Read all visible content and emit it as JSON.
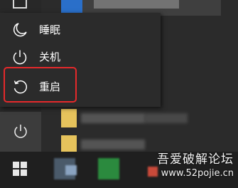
{
  "power_menu": {
    "items": [
      {
        "label": "睡眠",
        "icon": "moon-icon"
      },
      {
        "label": "关机",
        "icon": "power-icon"
      },
      {
        "label": "重启",
        "icon": "restart-icon"
      }
    ]
  },
  "sidebar": {
    "power_icon": "power-icon",
    "document_icon": "document-icon"
  },
  "taskbar": {
    "start_icon": "windows-logo-icon"
  },
  "watermark": {
    "line1": "吾爱破解论坛",
    "line2": "www.52pojie.cn"
  },
  "colors": {
    "highlight": "#e5292b",
    "menu_bg": "#2b2b2b",
    "text": "#ffffff"
  }
}
